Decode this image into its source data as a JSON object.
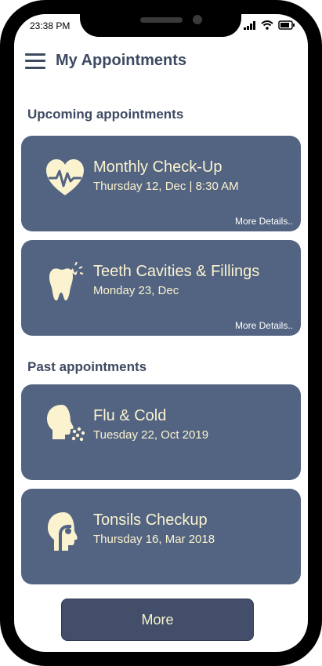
{
  "status_bar": {
    "time": "23:38 PM"
  },
  "header": {
    "title": "My Appointments"
  },
  "sections": {
    "upcoming": "Upcoming appointments",
    "past": "Past appointments"
  },
  "upcoming": [
    {
      "icon": "heart-pulse-icon",
      "title": "Monthly Check-Up",
      "date": "Thursday 12, Dec | 8:30 AM",
      "more": "More Details.."
    },
    {
      "icon": "tooth-icon",
      "title": "Teeth Cavities & Fillings",
      "date": " Monday 23, Dec",
      "more": "More Details.."
    }
  ],
  "past": [
    {
      "icon": "sneeze-head-icon",
      "title": "Flu & Cold",
      "date": "Tuesday 22, Oct 2019"
    },
    {
      "icon": "throat-head-icon",
      "title": "Tonsils Checkup",
      "date": " Thursday 16, Mar 2018"
    }
  ],
  "footer": {
    "more_label": "More"
  },
  "colors": {
    "accent": "#536482",
    "text_dark": "#3e4a62",
    "card_text": "#fbf3cf",
    "button": "#434f6a"
  }
}
